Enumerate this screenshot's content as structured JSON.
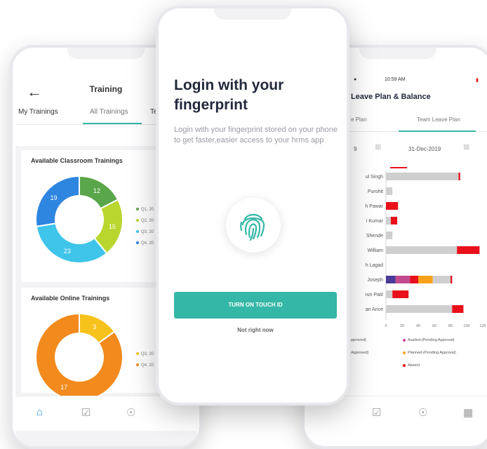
{
  "colors": {
    "teal": "#35b7a7",
    "blue": "#2e86e0",
    "green": "#5aa64a",
    "lime": "#b8d62e",
    "cyan": "#3fc4ea",
    "orange": "#f28a1e",
    "yellow": "#f7c21c",
    "red": "#e8101a",
    "gray": "#cfcfcf",
    "purple": "#4b3a96",
    "magenta": "#c34a8e",
    "amber": "#f7a21a"
  },
  "left_phone": {
    "back_icon": "arrow-left-icon",
    "title": "Training",
    "tabs": [
      "My Trainings",
      "All Trainings",
      "Te..."
    ],
    "classroom_card": {
      "title": "Available Classroom Trainings",
      "legend": [
        "Q1, 20",
        "Q2, 20",
        "Q3, 20",
        "Q4, 20"
      ]
    },
    "online_card": {
      "title": "Available Online Trainings",
      "legend": [
        "Q3, 20",
        "Q4, 20"
      ]
    },
    "nav_icons": [
      "home-icon",
      "checkbox-icon",
      "bell-icon"
    ]
  },
  "center_phone": {
    "title": "Login with your fingerprint",
    "description": "Login with your fingerprint stored on your phone to get faster,easier access to your hrms app",
    "icon": "fingerprint-icon",
    "primary_button": "TURN ON TOUCH ID",
    "secondary_link": "Not right now"
  },
  "right_phone": {
    "time": "10:59 AM",
    "title": "Leave Plan & Balance",
    "tabs": [
      "e Plan",
      "Team Leave Plan"
    ],
    "date_start": "9",
    "date_end": "31-Dec-2019",
    "names": [
      "ul Singh",
      "Purohit",
      "h Pawar",
      "i Kumar",
      "Shende",
      "William",
      "h Lagad",
      "Joseph",
      "run Patil",
      "an Ance"
    ],
    "x_ticks": [
      "0",
      "20",
      "40",
      "60",
      "80",
      "100",
      "120"
    ],
    "legend": [
      "pproved)",
      "Availed-(Pending Approval)",
      "Approved)",
      "Planned-(Pending Approval)",
      "Absent"
    ],
    "nav_icons": [
      "checkbox-icon",
      "bell-icon",
      "grid-icon"
    ]
  },
  "chart_data": [
    {
      "type": "pie",
      "title": "Available Classroom Trainings",
      "categories": [
        "Q1",
        "Q2",
        "Q3",
        "Q4"
      ],
      "values": [
        12,
        15,
        23,
        19
      ],
      "colors": [
        "#5aa64a",
        "#b8d62e",
        "#3fc4ea",
        "#2e86e0"
      ]
    },
    {
      "type": "pie",
      "title": "Available Online Trainings",
      "categories": [
        "Q3",
        "Q4"
      ],
      "values": [
        3,
        17
      ],
      "colors": [
        "#f7c21c",
        "#f28a1e"
      ]
    },
    {
      "type": "bar",
      "orientation": "horizontal",
      "categories": [
        "ul Singh",
        "Purohit",
        "h Pawar",
        "i Kumar",
        "Shende",
        "William",
        "h Lagad",
        "Joseph",
        "run Patil",
        "an Ance"
      ],
      "xlim": [
        0,
        120
      ],
      "segments": [
        [
          {
            "v": 90,
            "c": "gray"
          },
          {
            "v": 2,
            "c": "red"
          }
        ],
        [
          {
            "v": 8,
            "c": "gray"
          }
        ],
        [
          {
            "v": 15,
            "c": "red"
          }
        ],
        [
          {
            "v": 6,
            "c": "gray"
          },
          {
            "v": 8,
            "c": "red"
          }
        ],
        [
          {
            "v": 8,
            "c": "gray"
          }
        ],
        [
          {
            "v": 88,
            "c": "gray"
          },
          {
            "v": 28,
            "c": "red"
          }
        ],
        [
          {
            "v": 0,
            "c": "gray"
          }
        ],
        [
          {
            "v": 12,
            "c": "purple"
          },
          {
            "v": 18,
            "c": "magenta"
          },
          {
            "v": 10,
            "c": "red"
          },
          {
            "v": 18,
            "c": "amber"
          },
          {
            "v": 22,
            "c": "gray"
          },
          {
            "v": 2,
            "c": "red"
          }
        ],
        [
          {
            "v": 8,
            "c": "gray"
          },
          {
            "v": 20,
            "c": "red"
          }
        ],
        [
          {
            "v": 82,
            "c": "gray"
          },
          {
            "v": 14,
            "c": "red"
          }
        ]
      ]
    }
  ]
}
